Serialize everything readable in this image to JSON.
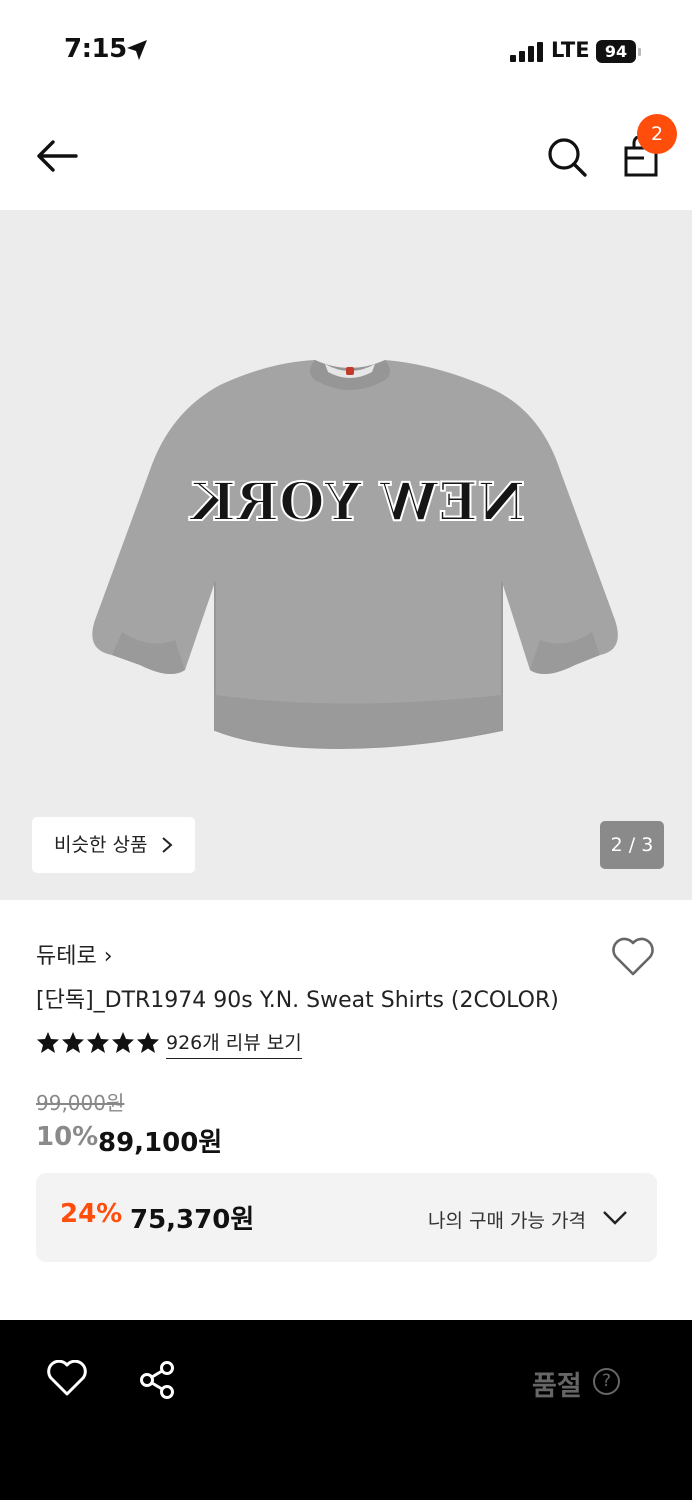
{
  "status_bar": {
    "time": "7:15",
    "network": "LTE",
    "battery": "94"
  },
  "header": {
    "cart_count": "2",
    "icons": [
      "back-arrow-icon",
      "search-icon",
      "shopping-bag-icon"
    ]
  },
  "gallery": {
    "similar_button_label": "비슷한 상품",
    "page_indicator": "2 / 3",
    "image_subject": "gray crewneck sweatshirt with NEW YORK print"
  },
  "product": {
    "brand": "듀테로",
    "brand_chevron": "›",
    "title": "[단독]_DTR1974 90s Y.N. Sweat Shirts (2COLOR)",
    "rating_stars": 5,
    "review_link": "926개 리뷰 보기",
    "original_price": "99,000원",
    "discount_rate": "10%",
    "sale_price": "89,100원"
  },
  "my_price": {
    "rate": "24%",
    "price": "75,370원",
    "label": "나의 구매 가능 가격"
  },
  "bottom_bar": {
    "status_label": "품절",
    "help_icon_text": "?"
  },
  "colors": {
    "accent": "#ff4d0c",
    "gallery_bg": "#ececec",
    "bottom_bar_bg": "#000000",
    "sweatshirt": "#a3a3a3"
  }
}
